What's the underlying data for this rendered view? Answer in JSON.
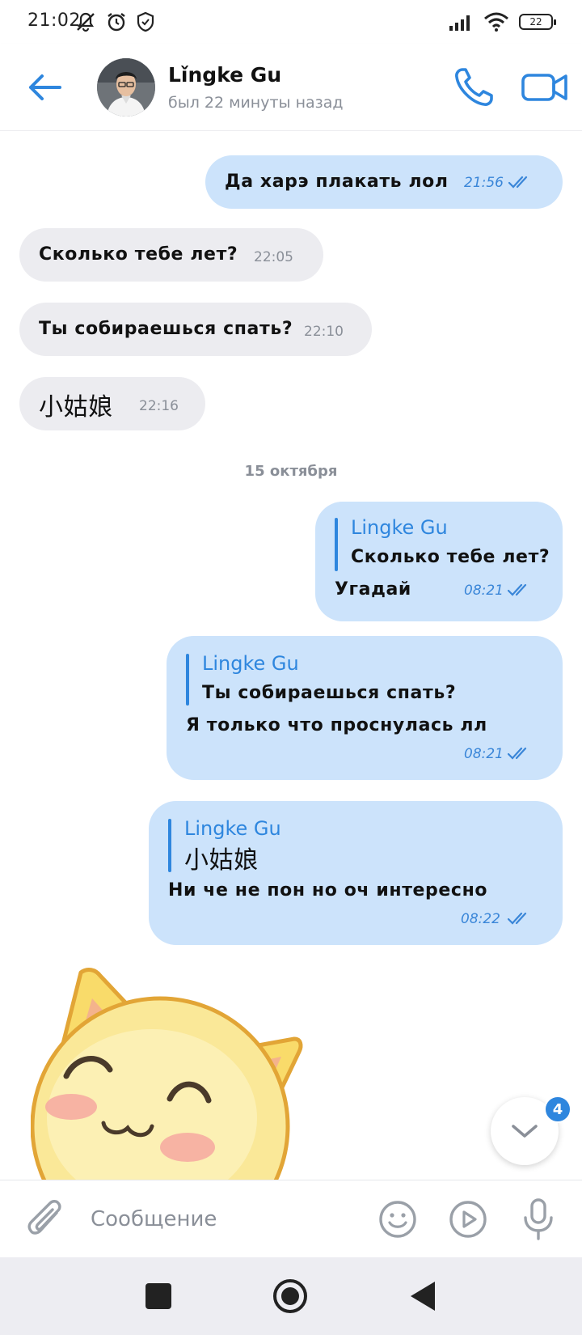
{
  "status_bar": {
    "time": "21:02",
    "battery": "22",
    "icons": [
      "mute-icon",
      "alarm-icon",
      "shield-icon",
      "signal-icon",
      "wifi-icon",
      "battery-icon"
    ]
  },
  "header": {
    "contact_name": "Lǐngke Gu",
    "last_seen": "был 22 минуты назад",
    "accent_color": "#2e86de"
  },
  "messages": [
    {
      "direction": "out",
      "text": "Да харэ плакать лол",
      "time": "21:56",
      "read": true
    },
    {
      "direction": "in",
      "text": "Сколько тебе лет?",
      "time": "22:05"
    },
    {
      "direction": "in",
      "text": "Ты собираешься спать?",
      "time": "22:10"
    },
    {
      "direction": "in",
      "text": "小姑娘",
      "time": "22:16"
    },
    {
      "direction": "out",
      "reply_to": {
        "name": "Lingke Gu",
        "text": "Сколько тебе лет?"
      },
      "text": "Угадай",
      "time": "08:21",
      "read": true
    },
    {
      "direction": "out",
      "reply_to": {
        "name": "Lingke Gu",
        "text": "Ты собираешься спать?"
      },
      "text": "Я только что проснулась лл",
      "time": "08:21",
      "read": true
    },
    {
      "direction": "out",
      "reply_to": {
        "name": "Lingke Gu",
        "text": "小姑娘"
      },
      "text": "Ни че не пон но оч интересно",
      "time": "08:22",
      "read": true
    }
  ],
  "date_separator": "15 октября",
  "sticker": "cat-sticker",
  "scroll_down": {
    "unread_count": "4"
  },
  "composer": {
    "placeholder": "Сообщение"
  },
  "colors": {
    "outgoing_bubble": "#cce3fb",
    "incoming_bubble": "#ececf0",
    "time_outgoing": "#3a86d8"
  }
}
